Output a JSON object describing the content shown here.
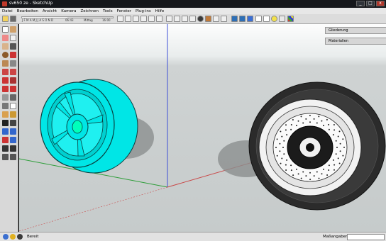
{
  "window": {
    "title": "sv650 ze - SketchUp",
    "minimize": "_",
    "maximize": "□",
    "close": "x"
  },
  "menu": [
    "Datei",
    "Bearbeiten",
    "Ansicht",
    "Kamera",
    "Zeichnen",
    "Tools",
    "Fenster",
    "Plug-ins",
    "Hilfe"
  ],
  "shadow_bar": {
    "months": "J F M A M J J A S O N D",
    "time_start": "06:43",
    "time_mid": "Mittag",
    "time_end": "16:00"
  },
  "panels": [
    {
      "label": "Gliederung",
      "button": "x"
    },
    {
      "label": "Materialien",
      "button": "x"
    }
  ],
  "status": {
    "state": "Bereit",
    "measure_label": "Maßangaben",
    "measure_value": ""
  },
  "colors": {
    "wheel_left": "#00e6e6",
    "wheel_left_outline": "#0a3f3f",
    "tire_right": "#2b2b2b",
    "axis_red": "#c94c4c",
    "axis_green": "#2e9e3a",
    "axis_blue": "#3d4fd6",
    "sky": "#fdfdfd",
    "ground": "#c8cdcd"
  }
}
